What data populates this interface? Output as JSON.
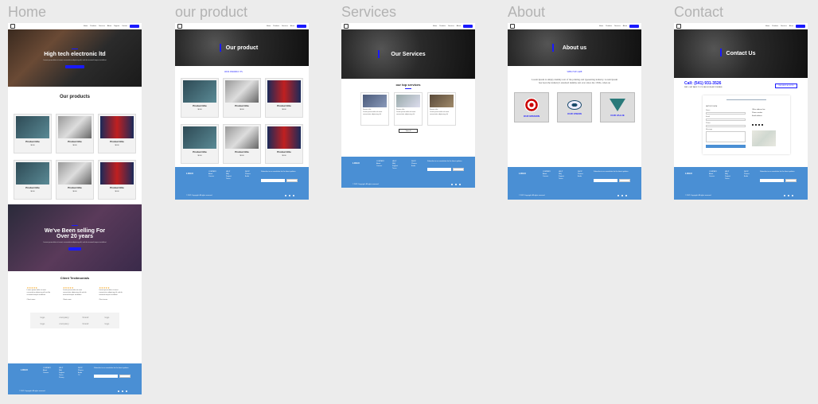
{
  "labels": [
    "Home",
    "our product",
    "Services",
    "About",
    "Contact"
  ],
  "nav": {
    "items": [
      "Home",
      "Products",
      "Services",
      "About",
      "Support",
      "Contact"
    ]
  },
  "home": {
    "hero_title": "High tech electronic ltd",
    "hero_text": "Lorem ipsum dolor sit amet, consectetur adipiscing elit, sed do eiusmod tempor incididunt",
    "products_title": "Our products",
    "product_title": "Product title",
    "product_price": "$0.00",
    "banner_title": "We've Been selling For Over 20 years",
    "testimonials_title": "Client Testimonials",
    "stars": "★★★★★",
    "testimonial_text": "Lorem ipsum dolor sit amet consectetur adipiscing elit sed do eiusmod tempor incididunt",
    "testimonial_name": "Client name",
    "partners": [
      "logo",
      "company",
      "brand",
      "logo",
      "logo",
      "company",
      "brand",
      "logo"
    ]
  },
  "product": {
    "hero_title": "Our product",
    "section_label": "OUR PRODUCTS",
    "product_title": "Product title",
    "product_price": "$0.00"
  },
  "services": {
    "hero_title": "Our Services",
    "section_title": "our top services",
    "card_title": "Service title",
    "card_text": "Lorem ipsum dolor sit amet consectetur adipiscing elit",
    "card_btn": "Read more",
    "more_btn": "View all"
  },
  "about": {
    "hero_title": "About us",
    "section_label": "WHO WE ARE",
    "intro_text": "Lorem Ipsum is simply dummy text of the printing and typesetting industry. Lorem Ipsum has been the industry's standard dummy text ever since the 1500s, when an",
    "mission": "OUR MISSION",
    "vision": "OUR VISION",
    "value": "OUR VALUE"
  },
  "contact": {
    "hero_title": "Contact Us",
    "phone": "Call: (541) 931-3526",
    "tagline": "WE'LL GET BACK TO YOU AS SOON AS POSSIBLE",
    "button": "REQUEST A QUOTE",
    "form_title": "GET IN TOUCH",
    "form_fields": [
      "Name",
      "Email",
      "Phone",
      "Message"
    ],
    "info": [
      "Office address line",
      "Phone number",
      "Email address"
    ]
  },
  "footer": {
    "logo": "LOGO",
    "col1": [
      "COMPANY",
      "About",
      "Careers"
    ],
    "col2": [
      "HELP",
      "FAQ",
      "Support",
      "Terms",
      "Privacy"
    ],
    "col3": [
      "SHOP",
      "Phones",
      "Audio",
      "TV"
    ],
    "newsletter": "Subscribe to our newsletter for the latest updates",
    "subscribe": "Subscribe",
    "copyright": "© 2021 Copyright. All rights reserved"
  },
  "colors": {
    "accent": "#1a1aff",
    "footer": "#4a8fd4",
    "label": "#b3b3b3"
  }
}
